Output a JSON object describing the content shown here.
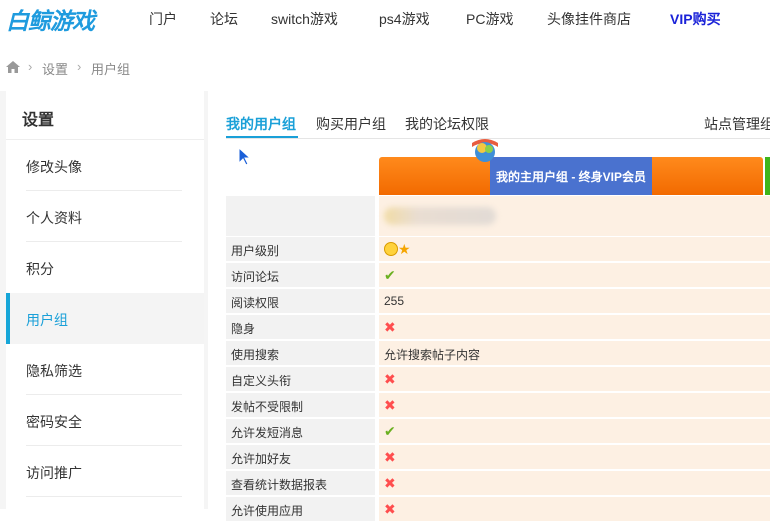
{
  "logo": "白鲸游戏",
  "nav": [
    {
      "label": "门户"
    },
    {
      "label": "论坛"
    },
    {
      "label": "switch游戏"
    },
    {
      "label": "ps4游戏"
    },
    {
      "label": "PC游戏"
    },
    {
      "label": "头像挂件商店"
    },
    {
      "label": "VIP购买"
    }
  ],
  "breadcrumb": {
    "sep": "›",
    "items": [
      "设置",
      "用户组"
    ]
  },
  "sidebar": {
    "title": "设置",
    "items": [
      {
        "label": "修改头像"
      },
      {
        "label": "个人资料"
      },
      {
        "label": "积分"
      },
      {
        "label": "用户组"
      },
      {
        "label": "隐私筛选"
      },
      {
        "label": "密码安全"
      },
      {
        "label": "访问推广"
      }
    ]
  },
  "tabs": [
    {
      "label": "我的用户组"
    },
    {
      "label": "购买用户组"
    },
    {
      "label": "我的论坛权限"
    }
  ],
  "management_link": "站点管理组",
  "group_header": "我的主用户组 - 终身VIP会员",
  "permissions": [
    {
      "label": "用户级别",
      "value": "",
      "icon": "smile-star-icon"
    },
    {
      "label": "访问论坛",
      "value": "",
      "icon": "check-icon"
    },
    {
      "label": "阅读权限",
      "value": "255",
      "icon": ""
    },
    {
      "label": "隐身",
      "value": "",
      "icon": "cross-icon"
    },
    {
      "label": "使用搜索",
      "value": "允许搜索帖子内容",
      "icon": ""
    },
    {
      "label": "自定义头衔",
      "value": "",
      "icon": "cross-icon"
    },
    {
      "label": "发帖不受限制",
      "value": "",
      "icon": "cross-icon"
    },
    {
      "label": "允许发短消息",
      "value": "",
      "icon": "check-icon"
    },
    {
      "label": "允许加好友",
      "value": "",
      "icon": "cross-icon"
    },
    {
      "label": "查看统计数据报表",
      "value": "",
      "icon": "cross-icon"
    },
    {
      "label": "允许使用应用",
      "value": "",
      "icon": "cross-icon"
    }
  ],
  "colors": {
    "accent": "#1aa0d8",
    "vip": "#1a22d8",
    "header_orange": "#f26a00",
    "header_blue": "#4a72cf",
    "check": "#6bb021",
    "cross": "#ff4e4e"
  }
}
